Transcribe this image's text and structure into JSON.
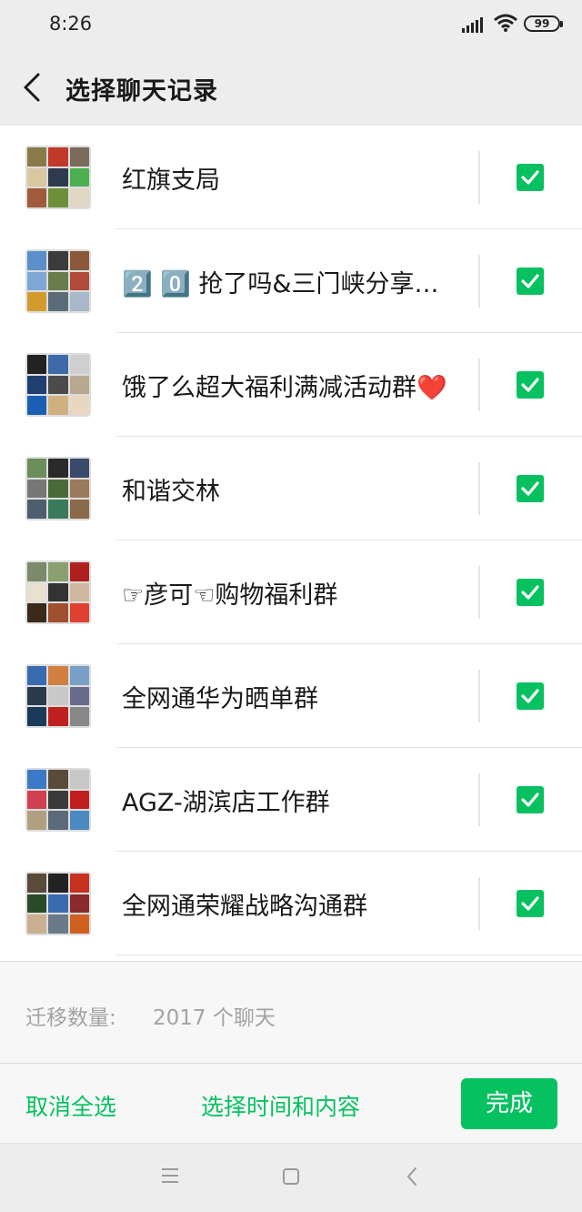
{
  "status_bar": {
    "time": "8:26",
    "battery": "99"
  },
  "header": {
    "title": "选择聊天记录"
  },
  "chats": [
    {
      "name": "红旗支局",
      "checked": true,
      "avatar_colors": [
        "#8a7a4a",
        "#c0392b",
        "#7a6b5a",
        "#d9c8a0",
        "#2e3b4e",
        "#4caf50",
        "#a05a3c",
        "#6d8f3a",
        "#e0d6c4"
      ]
    },
    {
      "name": "2️⃣ 0️⃣ 抢了吗&三门峡分享…",
      "checked": true,
      "avatar_colors": [
        "#5b8fc9",
        "#3b3b3b",
        "#8a5a3a",
        "#7fa7d6",
        "#6a7b4c",
        "#b04a3a",
        "#d39b2e",
        "#5c6b7a",
        "#a8b8c8"
      ]
    },
    {
      "name": "饿了么超大福利满减活动群❤️",
      "checked": true,
      "avatar_colors": [
        "#222",
        "#3e6aa8",
        "#cfcfcf",
        "#1f3f70",
        "#4b4b4b",
        "#b8a890",
        "#1a5fb4",
        "#d0b080",
        "#e8d8c0"
      ]
    },
    {
      "name": "和谐交林",
      "checked": true,
      "avatar_colors": [
        "#6b8e5a",
        "#2a2a2a",
        "#3a4a6a",
        "#777",
        "#4a6a3a",
        "#9a7a5a",
        "#4e5e6e",
        "#3a7a5a",
        "#8a6a4a"
      ]
    },
    {
      "name": "☞彦可☜购物福利群",
      "checked": true,
      "avatar_colors": [
        "#7a8a6a",
        "#8aa070",
        "#b02020",
        "#e8e0d0",
        "#333",
        "#d0b8a0",
        "#3a2a1a",
        "#a05030",
        "#e04030"
      ]
    },
    {
      "name": "全网通华为晒单群",
      "checked": true,
      "avatar_colors": [
        "#3a6ab0",
        "#d08040",
        "#7aa0c8",
        "#2a3a4a",
        "#c8c8c8",
        "#6a6a8a",
        "#1a3a5a",
        "#c02020",
        "#888"
      ]
    },
    {
      "name": "AGZ-湖滨店工作群",
      "checked": true,
      "avatar_colors": [
        "#3a7ac8",
        "#5a4a3a",
        "#c8c8c8",
        "#d04050",
        "#3a3a3a",
        "#c02020",
        "#b0a080",
        "#5a6a7a",
        "#4a8ac0"
      ]
    },
    {
      "name": "全网通荣耀战略沟通群",
      "checked": true,
      "avatar_colors": [
        "#5a4a3a",
        "#222",
        "#c83020",
        "#2a4a2a",
        "#3a6ab0",
        "#8a2a2a",
        "#c8b090",
        "#6a7a8a",
        "#d06020"
      ]
    }
  ],
  "migration": {
    "label": "迁移数量:",
    "value": "2017 个聊天"
  },
  "toolbar": {
    "deselect_all": "取消全选",
    "select_time_content": "选择时间和内容",
    "done": "完成"
  },
  "colors": {
    "accent": "#07c160",
    "header_bg": "#ededed"
  }
}
